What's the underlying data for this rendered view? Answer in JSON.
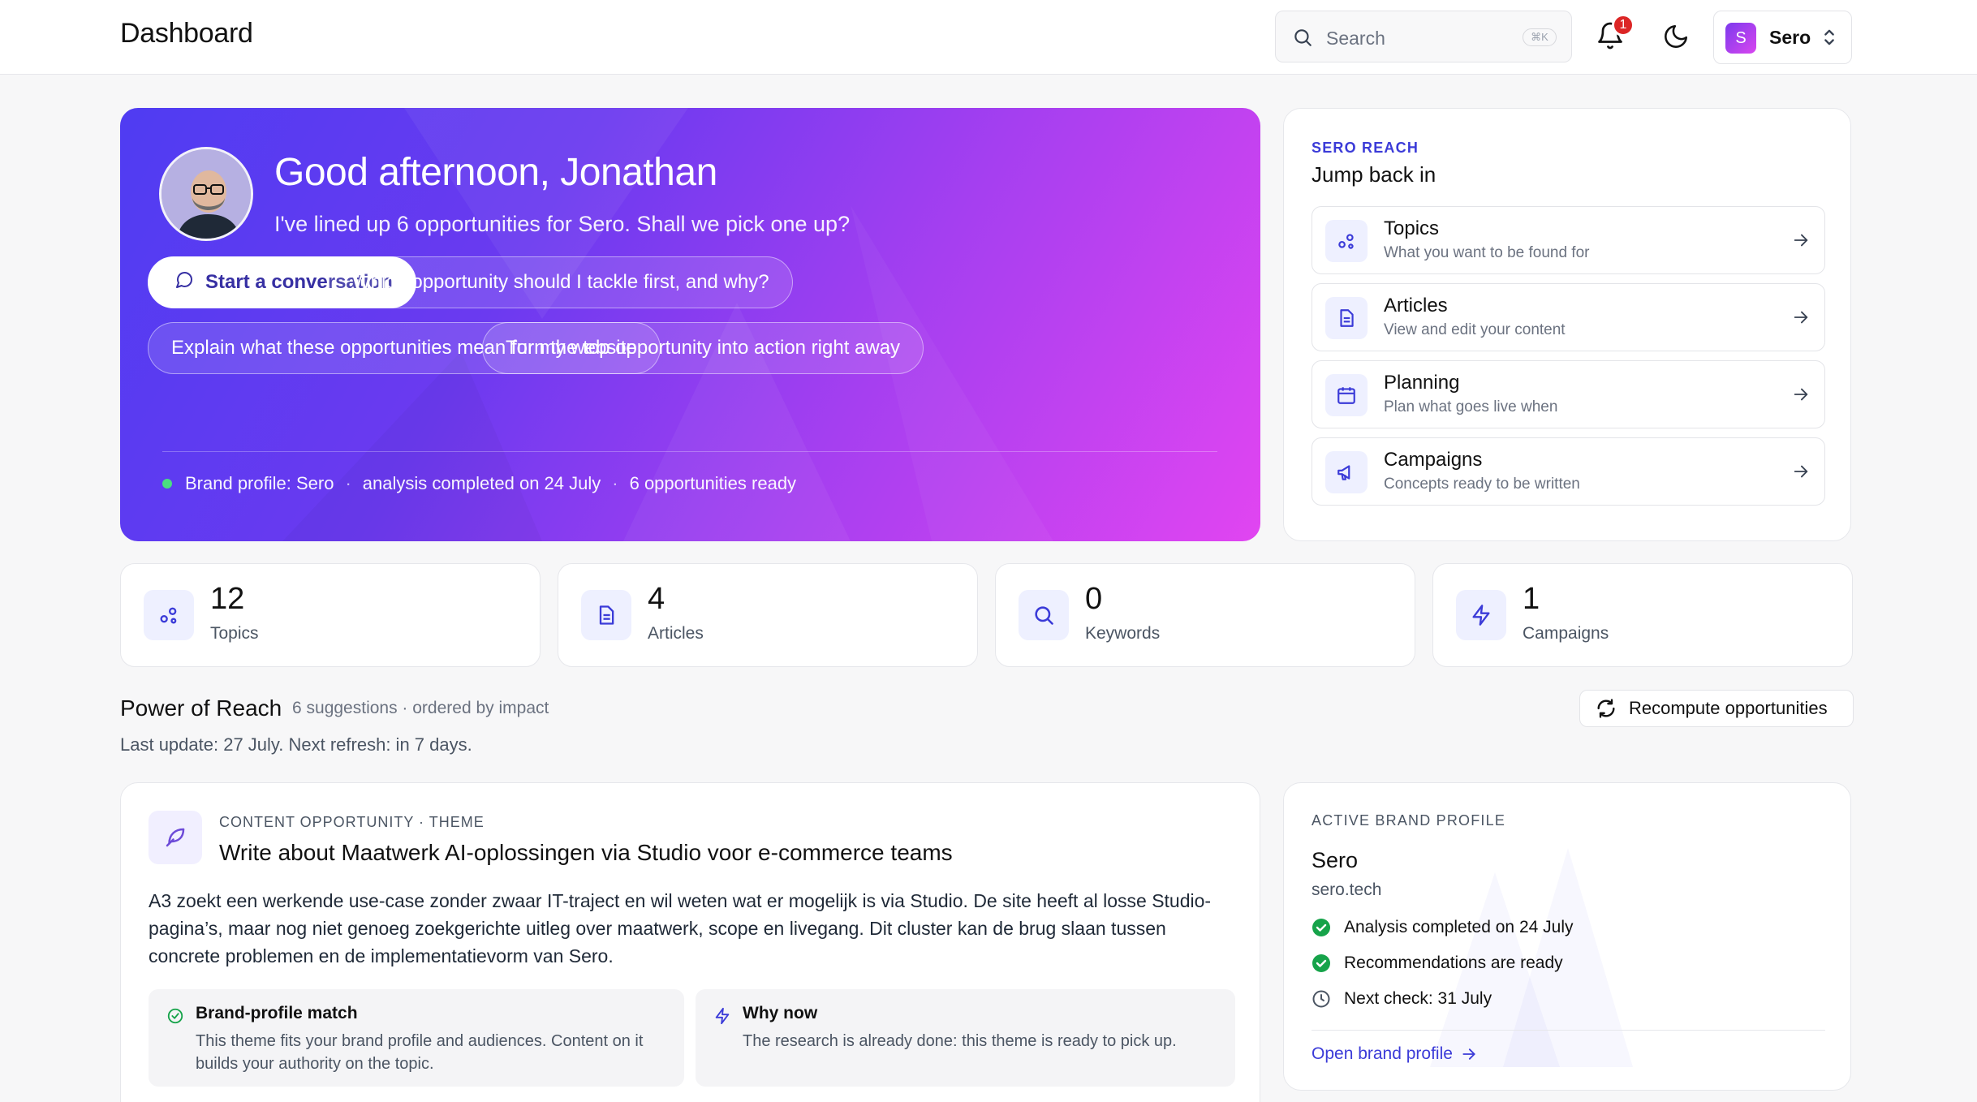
{
  "header": {
    "title": "Dashboard",
    "search_placeholder": "Search",
    "search_shortcut": "⌘K",
    "notifications_count": "1",
    "account_initial": "S",
    "account_name": "Sero"
  },
  "hero": {
    "greeting": "Good afternoon, Jonathan",
    "subtitle": "I've lined up 6 opportunities for Sero. Shall we pick one up?",
    "primary_action": "Start a conversation",
    "suggestions": [
      "Which opportunity should I tackle first, and why?",
      "Explain what these opportunities mean for my website",
      "Turn the top opportunity into action right away"
    ],
    "status": {
      "brand": "Brand profile: Sero",
      "analysis": "analysis completed on 24 July",
      "ready": "6 opportunities ready",
      "separator": "·"
    }
  },
  "jump_back_in": {
    "eyebrow": "SERO REACH",
    "title": "Jump back in",
    "items": [
      {
        "title": "Topics",
        "description": "What you want to be found for",
        "icon": "topics-icon"
      },
      {
        "title": "Articles",
        "description": "View and edit your content",
        "icon": "document-icon"
      },
      {
        "title": "Planning",
        "description": "Plan what goes live when",
        "icon": "calendar-icon"
      },
      {
        "title": "Campaigns",
        "description": "Concepts ready to be written",
        "icon": "megaphone-icon"
      }
    ]
  },
  "stats": [
    {
      "value": "12",
      "label": "Topics",
      "icon": "topics-icon"
    },
    {
      "value": "4",
      "label": "Articles",
      "icon": "document-icon"
    },
    {
      "value": "0",
      "label": "Keywords",
      "icon": "search-icon"
    },
    {
      "value": "1",
      "label": "Campaigns",
      "icon": "bolt-icon"
    }
  ],
  "power_of_reach": {
    "title": "Power of Reach",
    "meta": "6 suggestions · ordered by impact",
    "last_update": "Last update: 27 July. Next refresh: in 7 days.",
    "recompute_label": "Recompute opportunities"
  },
  "opportunity": {
    "eyebrow": "CONTENT OPPORTUNITY · THEME",
    "headline": "Write about Maatwerk AI-oplossingen via Studio voor e-commerce teams",
    "body": "A3 zoekt een werkende use-case zonder zwaar IT-traject en wil weten wat er mogelijk is via Studio. De site heeft al losse Studio-pagina’s, maar nog niet genoeg zoekgerichte uitleg over maatwerk, scope en livegang. Dit cluster kan de brug slaan tussen concrete problemen en de implementatievorm van Sero.",
    "reasons": [
      {
        "title": "Brand-profile match",
        "description": "This theme fits your brand profile and audiences. Content on it builds your authority on the topic.",
        "icon": "check-circle-icon"
      },
      {
        "title": "Why now",
        "description": "The research is already done: this theme is ready to pick up.",
        "icon": "bolt-icon"
      }
    ]
  },
  "brand_profile": {
    "eyebrow": "ACTIVE BRAND PROFILE",
    "name": "Sero",
    "domain": "sero.tech",
    "checks": [
      {
        "text": "Analysis completed on 24 July",
        "icon": "check-filled-icon"
      },
      {
        "text": "Recommendations are ready",
        "icon": "check-filled-icon"
      },
      {
        "text": "Next check: 31 July",
        "icon": "clock-icon"
      }
    ],
    "link_label": "Open brand profile"
  },
  "colors": {
    "accent": "#3b3bd8",
    "hero_gradient_start": "#4f3cf2",
    "hero_gradient_end": "#e145f1",
    "success": "#16a34a",
    "badge": "#dc2626"
  }
}
